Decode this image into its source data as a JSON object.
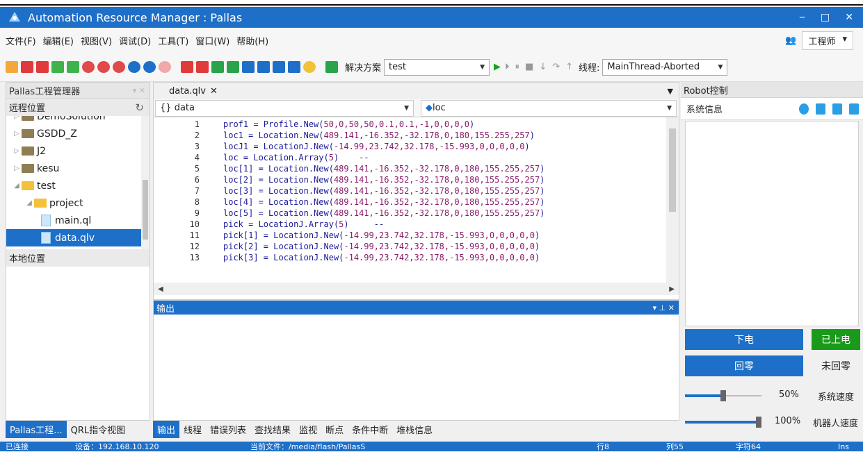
{
  "window": {
    "title": "Automation Resource Manager : Pallas"
  },
  "menu": [
    "文件(F)",
    "编辑(E)",
    "视图(V)",
    "调试(D)",
    "工具(T)",
    "窗口(W)",
    "帮助(H)"
  ],
  "user": {
    "role": "工程师"
  },
  "toolbar": {
    "solution_label": "解决方案",
    "solution_value": "test",
    "thread_label": "线程:",
    "thread_value": "MainThread-Aborted"
  },
  "project_panel": {
    "title": "Pallas工程管理器",
    "remote_label": "远程位置",
    "local_label": "本地位置",
    "tree": [
      {
        "label": "DemoSolution",
        "type": "folder"
      },
      {
        "label": "GSDD_Z",
        "type": "folder"
      },
      {
        "label": "J2",
        "type": "folder"
      },
      {
        "label": "kesu",
        "type": "folder"
      },
      {
        "label": "test",
        "type": "folder-open"
      },
      {
        "label": "project",
        "type": "folder-open"
      },
      {
        "label": "main.ql",
        "type": "file"
      },
      {
        "label": "data.qlv",
        "type": "file",
        "selected": true
      }
    ],
    "bottom_tabs": [
      "Pallas工程...",
      "QRL指令视图"
    ]
  },
  "editor": {
    "tab": "data.qlv",
    "left_nav": "data",
    "right_nav": "loc",
    "lines": [
      {
        "n": "1",
        "code": "prof1 = Profile.New(",
        "args": "50,0,50,50,0.1,0.1,-1,0,0,0,0",
        "tail": ")"
      },
      {
        "n": "2",
        "code": "loc1 = Location.New(",
        "args": "489.141,-16.352,-32.178,0,180,155.255,257",
        "tail": ")"
      },
      {
        "n": "3",
        "code": "locJ1 = LocationJ.New(",
        "args": "-14.99,23.742,32.178,-15.993,0,0,0,0,0",
        "tail": ")"
      },
      {
        "n": "4",
        "code": "loc = Location.Array(",
        "args": "5",
        "tail": ")    --"
      },
      {
        "n": "5",
        "code": "loc[1] = Location.New(",
        "args": "489.141,-16.352,-32.178,0,180,155.255,257",
        "tail": ")"
      },
      {
        "n": "6",
        "code": "loc[2] = Location.New(",
        "args": "489.141,-16.352,-32.178,0,180,155.255,257",
        "tail": ")"
      },
      {
        "n": "7",
        "code": "loc[3] = Location.New(",
        "args": "489.141,-16.352,-32.178,0,180,155.255,257",
        "tail": ")"
      },
      {
        "n": "8",
        "code": "loc[4] = Location.New(",
        "args": "489.141,-16.352,-32.178,0,180,155.255,257",
        "tail": ")"
      },
      {
        "n": "9",
        "code": "loc[5] = Location.New(",
        "args": "489.141,-16.352,-32.178,0,180,155.255,257",
        "tail": ")"
      },
      {
        "n": "10",
        "code": "pick = LocationJ.Array(",
        "args": "5",
        "tail": ")     --"
      },
      {
        "n": "11",
        "code": "pick[1] = LocationJ.New(",
        "args": "-14.99,23.742,32.178,-15.993,0,0,0,0,0",
        "tail": ")"
      },
      {
        "n": "12",
        "code": "pick[2] = LocationJ.New(",
        "args": "-14.99,23.742,32.178,-15.993,0,0,0,0,0",
        "tail": ")"
      },
      {
        "n": "13",
        "code": "pick[3] = LocationJ.New(",
        "args": "-14.99,23.742,32.178,-15.993,0,0,0,0,0",
        "tail": ")"
      }
    ]
  },
  "output": {
    "title": "输出",
    "tabs": [
      "输出",
      "线程",
      "错误列表",
      "查找结果",
      "监视",
      "断点",
      "条件中断",
      "堆栈信息"
    ]
  },
  "robot": {
    "title": "Robot控制",
    "info_label": "系统信息",
    "power_off": "下电",
    "power_on": "已上电",
    "home": "回零",
    "not_homed": "未回零",
    "system_speed_value": "50%",
    "system_speed_label": "系统速度",
    "robot_speed_value": "100%",
    "robot_speed_label": "机器人速度",
    "system_speed_level": 0.5,
    "robot_speed_level": 1.0
  },
  "status": {
    "connected": "已连接",
    "device": "设备：192.168.10.120",
    "current_file": "当前文件：/media/flash/PallasS",
    "row": "行8",
    "col": "列55",
    "chars": "字符64",
    "mode": "Ins"
  },
  "colors": {
    "accent": "#1e6fc8",
    "green": "#1a9a1a"
  }
}
